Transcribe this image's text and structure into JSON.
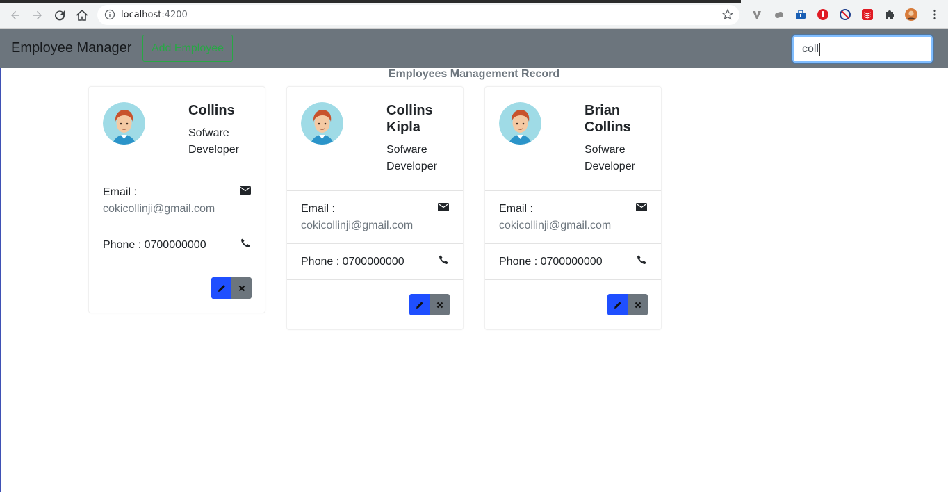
{
  "browser": {
    "url_host": "localhost",
    "url_port": ":4200"
  },
  "navbar": {
    "brand": "Employee Manager",
    "add_button": "Add Employee",
    "search_value": "coll"
  },
  "page": {
    "title": "Employees Management Record"
  },
  "employees": [
    {
      "name": "Collins",
      "job_title": "Sofware Developer",
      "email_label": "Email :",
      "email": "cokicollinji@gmail.com",
      "phone_label": "Phone : 0700000000"
    },
    {
      "name": "Collins Kipla",
      "job_title": "Sofware Developer",
      "email_label": "Email :",
      "email": "cokicollinji@gmail.com",
      "phone_label": "Phone : 0700000000"
    },
    {
      "name": "Brian Collins",
      "job_title": "Sofware Developer",
      "email_label": "Email :",
      "email": "cokicollinji@gmail.com",
      "phone_label": "Phone : 0700000000"
    }
  ],
  "colors": {
    "navbar_bg": "#6c757d",
    "add_button": "#28a745",
    "edit_button": "#1f4fff",
    "delete_button": "#6c757d"
  }
}
